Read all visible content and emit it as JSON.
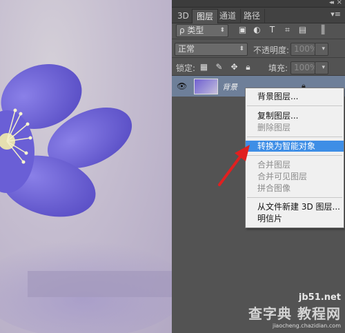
{
  "panel_tabs": [
    "3D",
    "图层",
    "通道",
    "路径"
  ],
  "panel_menu_icon": "panel-menu-icon",
  "filter": {
    "label": "ρ 类型"
  },
  "blend_mode": "正常",
  "opacity": {
    "label": "不透明度:",
    "value": "100%"
  },
  "lock": {
    "label": "锁定:"
  },
  "fill": {
    "label": "填充:",
    "value": "100%"
  },
  "layer": {
    "name": "背景"
  },
  "context_menu": {
    "items": [
      {
        "label": "背景图层...",
        "disabled": false
      },
      {
        "label": "复制图层...",
        "disabled": false
      },
      {
        "label": "删除图层",
        "disabled": true
      },
      {
        "label": "转换为智能对象",
        "disabled": false,
        "highlighted": true
      },
      {
        "label": "合并图层",
        "disabled": true
      },
      {
        "label": "合并可见图层",
        "disabled": true
      },
      {
        "label": "拼合图像",
        "disabled": true
      },
      {
        "label": "从文件新建 3D 图层...",
        "disabled": false
      },
      {
        "label": "明信片",
        "disabled": false
      }
    ]
  },
  "watermark": {
    "site": "jb51.net",
    "cn": "查字典 教程网",
    "url": "jiaocheng.chazidian.com"
  },
  "colors": {
    "highlight": "#3e8ee6",
    "arrow": "#e02020",
    "panel_bg": "#535353"
  }
}
